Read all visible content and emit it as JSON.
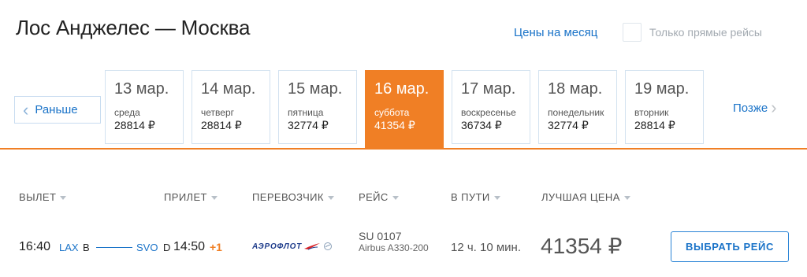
{
  "header": {
    "route": "Лос Анджелес — Москва",
    "month_prices_link": "Цены на месяц",
    "direct_only_label": "Только прямые рейсы",
    "direct_only_checked": false
  },
  "date_nav": {
    "prev_label": "Раньше",
    "next_label": "Позже",
    "days": [
      {
        "date": "13 мар.",
        "weekday": "среда",
        "price": "28814 ₽",
        "selected": false
      },
      {
        "date": "14 мар.",
        "weekday": "четверг",
        "price": "28814 ₽",
        "selected": false
      },
      {
        "date": "15 мар.",
        "weekday": "пятница",
        "price": "32774 ₽",
        "selected": false
      },
      {
        "date": "16 мар.",
        "weekday": "суббота",
        "price": "41354 ₽",
        "selected": true
      },
      {
        "date": "17 мар.",
        "weekday": "воскресенье",
        "price": "36734 ₽",
        "selected": false
      },
      {
        "date": "18 мар.",
        "weekday": "понедельник",
        "price": "32774 ₽",
        "selected": false
      },
      {
        "date": "19 мар.",
        "weekday": "вторник",
        "price": "28814 ₽",
        "selected": false
      }
    ]
  },
  "columns": {
    "departure": "ВЫЛЕТ",
    "arrival": "ПРИЛЕТ",
    "carrier": "ПЕРЕВОЗЧИК",
    "flight": "РЕЙС",
    "duration": "В ПУТИ",
    "best_price": "ЛУЧШАЯ ЦЕНА"
  },
  "flight": {
    "dep_time": "16:40",
    "dep_airport": "LAX",
    "dep_terminal": "B",
    "arr_airport": "SVO",
    "arr_terminal": "D",
    "arr_time": "14:50",
    "day_offset": "+1",
    "airline": "АЭРОФЛОТ",
    "flight_number": "SU 0107",
    "aircraft": "Airbus A330-200",
    "duration": "12 ч. 10 мин.",
    "price": "41354 ₽",
    "select_label": "ВЫБРАТЬ РЕЙС"
  },
  "colors": {
    "accent": "#f07f25",
    "link": "#1a73c8",
    "airline_brand": "#1d3b8a"
  }
}
